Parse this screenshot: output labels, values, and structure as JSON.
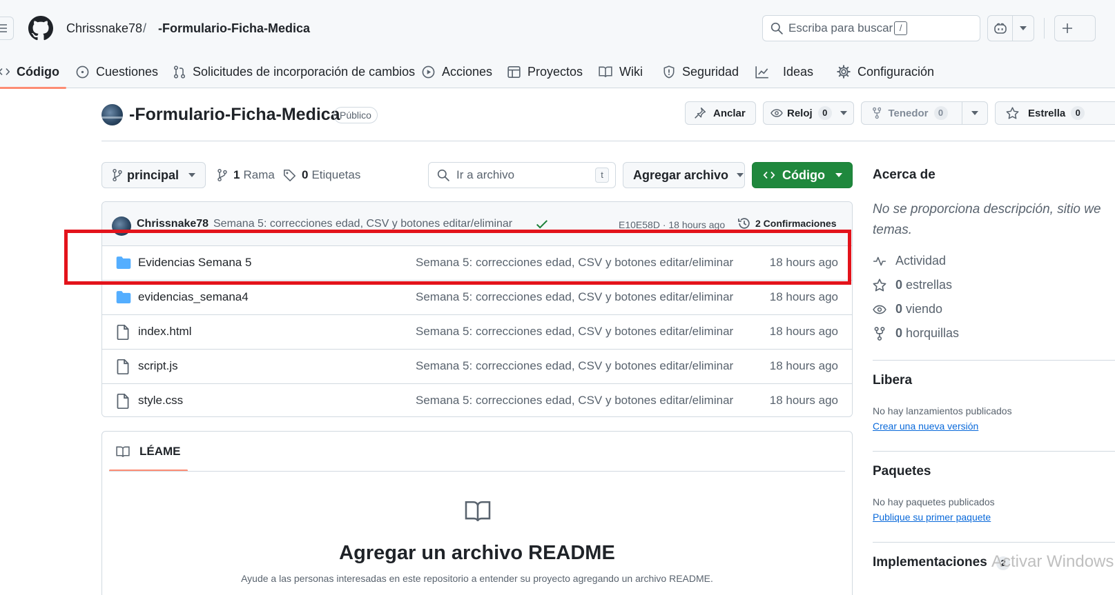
{
  "header": {
    "owner": "Chrissnake78",
    "separator": "/",
    "repo": "-Formulario-Ficha-Medica",
    "search_placeholder": "Escriba para buscar",
    "search_shortcut": "/"
  },
  "nav": {
    "tabs": [
      {
        "label": "Código",
        "icon": "code-icon",
        "active": true
      },
      {
        "label": "Cuestiones",
        "icon": "issue-icon"
      },
      {
        "label": "Solicitudes de incorporación de cambios",
        "icon": "pull-request-icon"
      },
      {
        "label": "Acciones",
        "icon": "play-icon"
      },
      {
        "label": "Proyectos",
        "icon": "table-icon"
      },
      {
        "label": "Wiki",
        "icon": "book-icon"
      },
      {
        "label": "Seguridad",
        "icon": "shield-icon"
      },
      {
        "label": "Ideas",
        "icon": "graph-icon"
      },
      {
        "label": "Configuración",
        "icon": "gear-icon"
      }
    ]
  },
  "repo_header": {
    "title": "-Formulario-Ficha-Medica",
    "visibility": "Público",
    "pin_label": "Anclar",
    "watch_label": "Reloj",
    "watch_count": "0",
    "fork_label": "Tenedor",
    "fork_count": "0",
    "star_label": "Estrella",
    "star_count": "0"
  },
  "toolbar": {
    "branch": "principal",
    "branches_count": "1",
    "branches_label": "Rama",
    "tags_count": "0",
    "tags_label": "Etiquetas",
    "goto_placeholder": "Ir a archivo",
    "goto_shortcut": "t",
    "add_file_label": "Agregar archivo",
    "code_label": "Código"
  },
  "commit": {
    "author": "Chrissnake78",
    "message": "Semana 5: correcciones edad, CSV y botones editar/eliminar",
    "hash_time": "E10E58D · 18 hours ago",
    "commits_label": "2 Confirmaciones"
  },
  "files": [
    {
      "type": "folder",
      "name": "Evidencias Semana 5",
      "message": "Semana 5: correcciones edad, CSV y botones editar/eliminar",
      "date": "18 hours ago"
    },
    {
      "type": "folder",
      "name": "evidencias_semana4",
      "message": "Semana 5: correcciones edad, CSV y botones editar/eliminar",
      "date": "18 hours ago"
    },
    {
      "type": "file",
      "name": "index.html",
      "message": "Semana 5: correcciones edad, CSV y botones editar/eliminar",
      "date": "18 hours ago"
    },
    {
      "type": "file",
      "name": "script.js",
      "message": "Semana 5: correcciones edad, CSV y botones editar/eliminar",
      "date": "18 hours ago"
    },
    {
      "type": "file",
      "name": "style.css",
      "message": "Semana 5: correcciones edad, CSV y botones editar/eliminar",
      "date": "18 hours ago"
    }
  ],
  "readme": {
    "tab_label": "LÉAME",
    "heading": "Agregar un archivo README",
    "subtext": "Ayude a las personas interesadas en este repositorio a entender su proyecto agregando un archivo README."
  },
  "sidebar": {
    "about_title": "Acerca de",
    "about_desc_line1": "No se proporciona descripción, sitio web ni",
    "about_desc_line2": "temas.",
    "activity_label": "Actividad",
    "stars_count": "0",
    "stars_label": "estrellas",
    "watching_count": "0",
    "watching_label": "viendo",
    "forks_count": "0",
    "forks_label": "horquillas",
    "releases_title": "Libera",
    "releases_empty": "No hay lanzamientos publicados",
    "releases_link": "Crear una nueva versión",
    "packages_title": "Paquetes",
    "packages_empty": "No hay paquetes publicados",
    "packages_link": "Publique su primer paquete",
    "deployments_title": "Implementaciones",
    "deployments_count": "2"
  },
  "watermark": "Activar Windows",
  "colors": {
    "accent_green": "#1f883d",
    "tab_underline": "#fd8c73",
    "highlight_red": "#e3131b",
    "link_blue": "#0969da",
    "folder_blue": "#54aeff"
  }
}
